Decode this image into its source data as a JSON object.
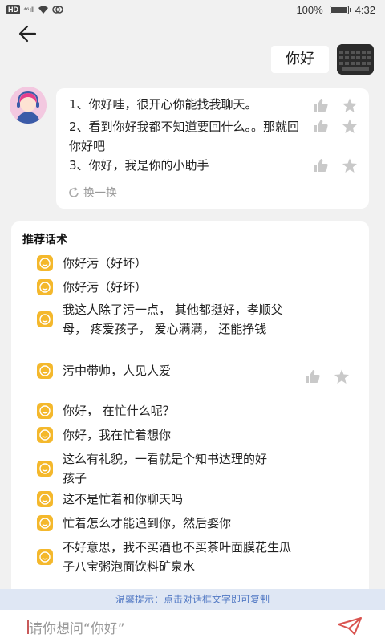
{
  "status_bar": {
    "hd": "HD",
    "signal": "⁴⁶ıll",
    "battery_pct": "100%",
    "time": "4:32"
  },
  "user_message": "你好",
  "bot_replies": [
    "1、你好哇，很开心你能找我聊天。",
    "2、看到你好我都不知道要回什么。。那就回你好吧",
    "3、你好，我是你的小助手"
  ],
  "refresh_label": "换一换",
  "suggestions": {
    "title": "推荐话术",
    "group1": [
      "你好污（好坏）",
      "你好污（好坏）",
      "我这人除了污一点， 其他都挺好，孝顺父母， 疼爱孩子， 爱心满满， 还能挣钱",
      "污中带帅，人见人爱"
    ],
    "group2": [
      "你好， 在忙什么呢？",
      "你好，我在忙着想你",
      "这么有礼貌，一看就是个知书达理的好孩子",
      "这不是忙着和你聊天吗",
      "忙着怎么才能追到你，然后娶你",
      "不好意思，我不买酒也不买茶叶面膜花生瓜子八宝粥泡面饮料矿泉水"
    ]
  },
  "tip": "温馨提示：点击对话框文字即可复制",
  "input": {
    "placeholder": "请你想问“你好”"
  },
  "colors": {
    "accent_yellow": "#f4b82c",
    "tip_blue": "#5279c4",
    "send_red": "#d9534f"
  }
}
